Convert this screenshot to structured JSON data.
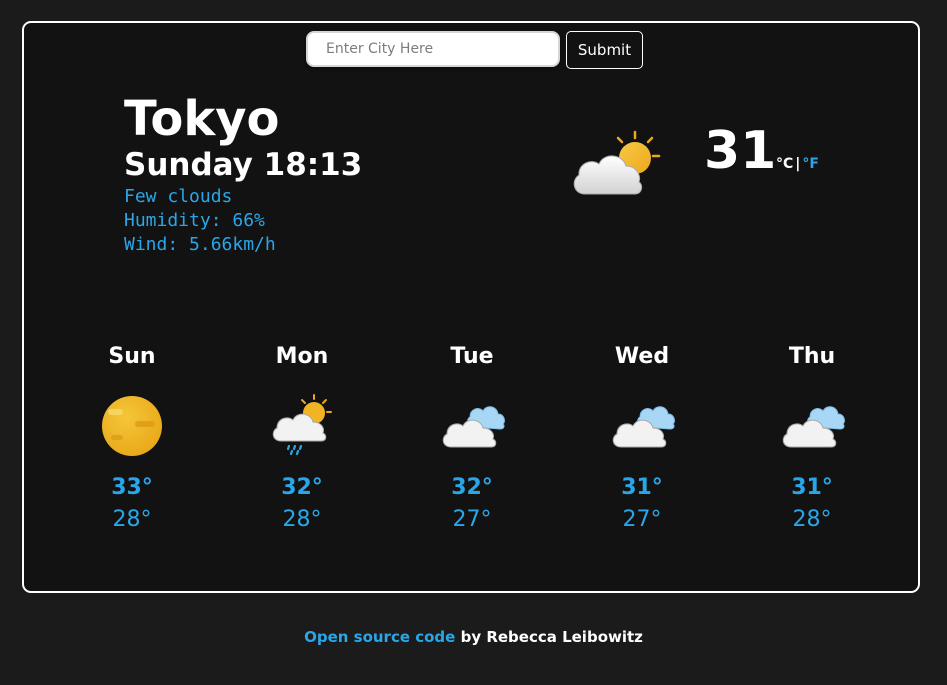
{
  "search": {
    "placeholder": "Enter City Here",
    "value": "",
    "submit_label": "Submit"
  },
  "current": {
    "city": "Tokyo",
    "datetime": "Sunday 18:13",
    "description": "Few clouds",
    "humidity": "Humidity: 66%",
    "wind": "Wind: 5.66km/h",
    "temperature": "31",
    "unit_celsius": "°C",
    "unit_separator": "|",
    "unit_fahrenheit": "°F",
    "icon": "few-clouds-day-icon",
    "active_unit": "celsius"
  },
  "forecast": [
    {
      "day": "Sun",
      "max": "33°",
      "min": "28°",
      "icon": "sun-icon"
    },
    {
      "day": "Mon",
      "max": "32°",
      "min": "28°",
      "icon": "rain-cloud-sun-icon"
    },
    {
      "day": "Tue",
      "max": "32°",
      "min": "27°",
      "icon": "clouds-icon"
    },
    {
      "day": "Wed",
      "max": "31°",
      "min": "27°",
      "icon": "clouds-icon"
    },
    {
      "day": "Thu",
      "max": "31°",
      "min": "28°",
      "icon": "clouds-icon"
    }
  ],
  "footer": {
    "link_text": "Open source code",
    "suffix": " by Rebecca Leibowitz"
  },
  "colors": {
    "accent": "#2aa6e8",
    "background": "#1b1b1b",
    "card": "#121212",
    "sun": "#f2b51f"
  }
}
